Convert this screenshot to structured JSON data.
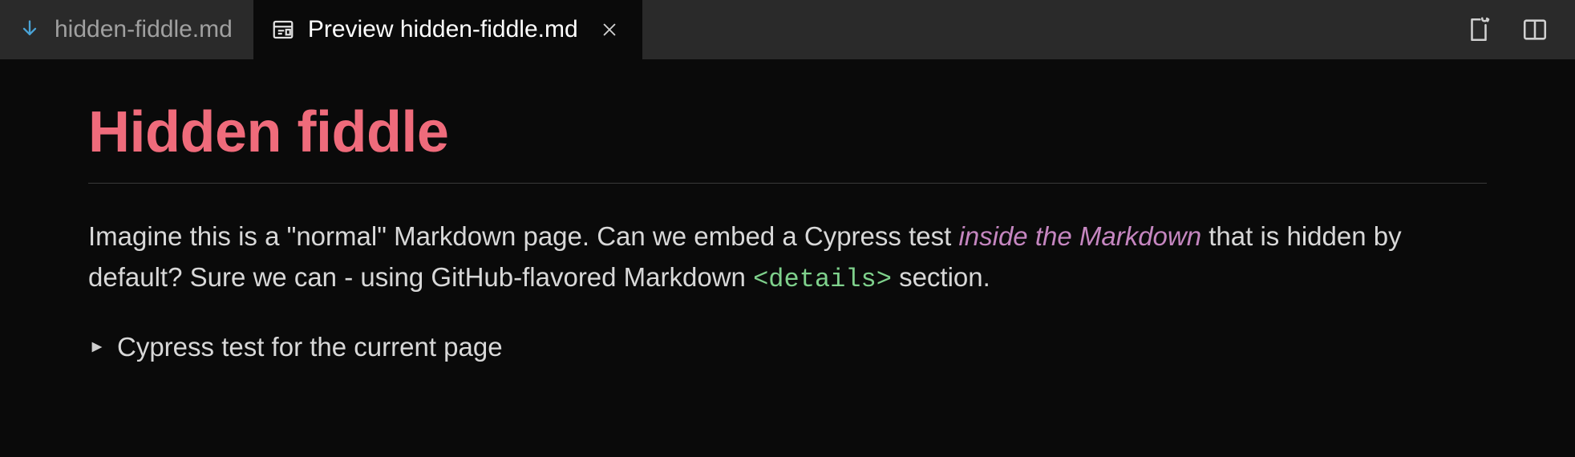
{
  "tabs": {
    "source": {
      "label": "hidden-fiddle.md"
    },
    "preview": {
      "label": "Preview hidden-fiddle.md"
    }
  },
  "doc": {
    "title": "Hidden fiddle",
    "para_part1": "Imagine this is a \"normal\" Markdown page. Can we embed a Cypress test ",
    "em_text": "inside the Markdown",
    "para_part2": " that is hidden by default? Sure we can - using GitHub-flavored Markdown ",
    "code_text": "<details>",
    "para_part3": " section.",
    "details_summary": "Cypress test for the current page"
  }
}
